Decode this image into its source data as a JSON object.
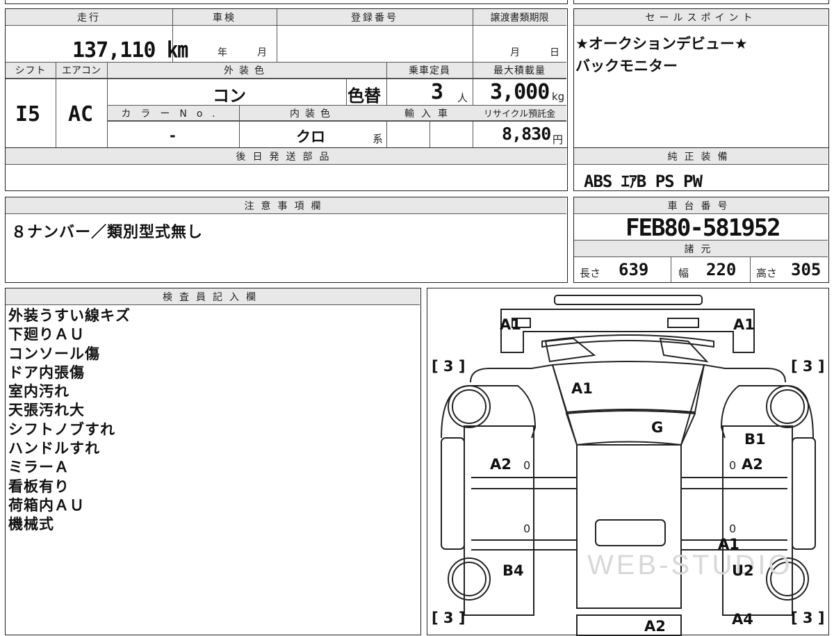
{
  "labels": {
    "mileage": "走行",
    "inspection": "車検",
    "registration": "登録番号",
    "transfer_deadline": "譲渡書類期限",
    "sales_point": "セールスポイント",
    "shift": "シフト",
    "aircon": "エアコン",
    "exterior_color": "外装色",
    "capacity": "乗車定員",
    "max_load": "最大積載量",
    "color_no": "カラーNo.",
    "interior_color": "内装色",
    "import": "輸入車",
    "recycle": "リサイクル預託金",
    "later_parts": "後日発送部品",
    "genuine_equipment": "純正装備",
    "notes": "注意事項欄",
    "chassis_number": "車台番号",
    "specs": "諸元",
    "inspector": "検査員記入欄",
    "year": "年",
    "month": "月",
    "day": "日",
    "person": "人",
    "kg": "kg",
    "yen": "円",
    "color_change": "色替",
    "kei": "系",
    "length": "長さ",
    "width": "幅",
    "height": "高さ"
  },
  "values": {
    "mileage": "137,110 ㎞",
    "shift": "I5",
    "aircon": "AC",
    "exterior_color": "コン",
    "capacity": "3",
    "max_load": "3,000",
    "color_no": "-",
    "interior_color": "クロ",
    "recycle": "8,830",
    "chassis_number": "FEB80-581952",
    "length": "639",
    "width": "220",
    "height": "305",
    "equipment": "ABS ｴｱB PS PW"
  },
  "sales_points": [
    "★オークションデビュー★",
    "バックモニター"
  ],
  "notes_text": "８ナンバー／類別型式無し",
  "inspector_remarks": [
    "外装うすい線キズ",
    "下廻りＡＵ",
    "コンソール傷",
    "ドア内張傷",
    "室内汚れ",
    "天張汚れ大",
    "シフトノブすれ",
    "ハンドルすれ",
    "ミラーＡ",
    "看板有り",
    "荷箱内ＡＵ",
    "機械式"
  ],
  "damage_marks": {
    "front_left": "A1",
    "front_right": "A1",
    "hood": "A1",
    "windshield": "G",
    "right_front_fender": "B1",
    "left_door": "A2",
    "right_door": "A2",
    "right_rear_body": "A1",
    "left_rear": "B4",
    "right_rear": "U2",
    "rear_bottom_left": "A2",
    "rear_bottom_right": "A4",
    "tire_front_left": "[ 3 ]",
    "tire_front_right": "[ 3 ]",
    "tire_rear_left": "[ 3 ]",
    "tire_rear_right": "[ 3 ]",
    "zero_1": "0",
    "zero_2": "0",
    "zero_3": "0",
    "zero_4": "0"
  },
  "watermark": "WEB-STUDIO"
}
